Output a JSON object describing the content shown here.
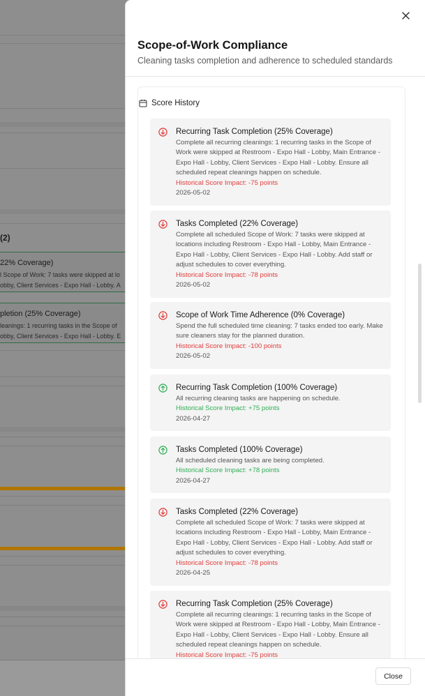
{
  "background": {
    "heading_fragment": "(2)",
    "cards": [
      {
        "title_fragment": "22% Coverage)",
        "line1_fragment": "l Scope of Work: 7 tasks were skipped at lo",
        "line2_fragment": "obby, Client Services - Expo Hall - Lobby. A"
      },
      {
        "title_fragment": "pletion (25% Coverage)",
        "line1_fragment": "leanings: 1 recurring tasks in the Scope of",
        "line2_fragment": "obby, Client Services - Expo Hall - Lobby. E"
      }
    ]
  },
  "panel": {
    "title": "Scope-of-Work Compliance",
    "subtitle": "Cleaning tasks completion and adherence to scheduled standards",
    "section_label": "Score History",
    "close_label": "Close"
  },
  "history": [
    {
      "direction": "down",
      "title": "Recurring Task Completion (25% Coverage)",
      "description": "Complete all recurring cleanings: 1 recurring tasks in the Scope of Work were skipped at Restroom - Expo Hall - Lobby, Main Entrance - Expo Hall - Lobby, Client Services - Expo Hall - Lobby. Ensure all scheduled repeat cleanings happen on schedule.",
      "impact": "Historical Score Impact: -75 points",
      "date": "2026-05-02"
    },
    {
      "direction": "down",
      "title": "Tasks Completed (22% Coverage)",
      "description": "Complete all scheduled Scope of Work: 7 tasks were skipped at locations including Restroom - Expo Hall - Lobby, Main Entrance - Expo Hall - Lobby, Client Services - Expo Hall - Lobby. Add staff or adjust schedules to cover everything.",
      "impact": "Historical Score Impact: -78 points",
      "date": "2026-05-02"
    },
    {
      "direction": "down",
      "title": "Scope of Work Time Adherence (0% Coverage)",
      "description": "Spend the full scheduled time cleaning: 7 tasks ended too early. Make sure cleaners stay for the planned duration.",
      "impact": "Historical Score Impact: -100 points",
      "date": "2026-05-02"
    },
    {
      "direction": "up",
      "title": "Recurring Task Completion (100% Coverage)",
      "description": "All recurring cleaning tasks are happening on schedule.",
      "impact": "Historical Score Impact: +75 points",
      "date": "2026-04-27"
    },
    {
      "direction": "up",
      "title": "Tasks Completed (100% Coverage)",
      "description": "All scheduled cleaning tasks are being completed.",
      "impact": "Historical Score Impact: +78 points",
      "date": "2026-04-27"
    },
    {
      "direction": "down",
      "title": "Tasks Completed (22% Coverage)",
      "description": "Complete all scheduled Scope of Work: 7 tasks were skipped at locations including Restroom - Expo Hall - Lobby, Main Entrance - Expo Hall - Lobby, Client Services - Expo Hall - Lobby. Add staff or adjust schedules to cover everything.",
      "impact": "Historical Score Impact: -78 points",
      "date": "2026-04-25"
    },
    {
      "direction": "down",
      "title": "Recurring Task Completion (25% Coverage)",
      "description": "Complete all recurring cleanings: 1 recurring tasks in the Scope of Work were skipped at Restroom - Expo Hall - Lobby, Main Entrance - Expo Hall - Lobby, Client Services - Expo Hall - Lobby. Ensure all scheduled repeat cleanings happen on schedule.",
      "impact": "Historical Score Impact: -75 points",
      "date": ""
    }
  ],
  "colors": {
    "negative": "#e23b3b",
    "positive": "#2fae55",
    "background_accent_bar": "#b07600"
  },
  "icons": {
    "close": "close-icon",
    "section": "calendar-icon",
    "negative": "arrow-down-circle-icon",
    "positive": "arrow-up-circle-icon"
  }
}
